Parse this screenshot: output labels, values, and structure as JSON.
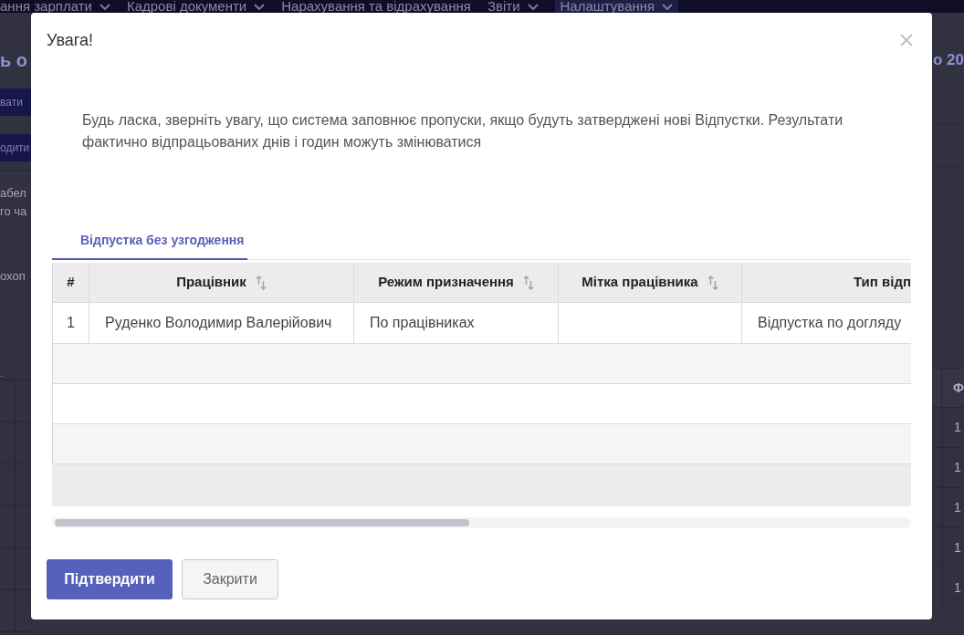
{
  "background": {
    "nav": [
      {
        "label": "ання зарплати",
        "has_menu": true,
        "selected": false
      },
      {
        "label": "Кадрові документи",
        "has_menu": true,
        "selected": false
      },
      {
        "label": "Нарахування та відрахування",
        "has_menu": false,
        "selected": false
      },
      {
        "label": "Звіти",
        "has_menu": true,
        "selected": false
      },
      {
        "label": "Налаштування",
        "has_menu": true,
        "selected": true
      }
    ],
    "page_title_parts": [
      "ь о",
      "о 20"
    ],
    "buttons": [
      "вати",
      "одити"
    ],
    "paragraphs": [
      {
        "lines": [
          "абел",
          "го ча"
        ]
      },
      {
        "lines": [
          "охоп"
        ]
      }
    ],
    "side_table": {
      "header": "Ф",
      "cells": [
        "1",
        "1",
        "1",
        "1",
        "1"
      ]
    }
  },
  "dialog": {
    "title": "Увага!",
    "message": "Будь ласка, зверніть увагу, що система заповнює пропуски, якщо будуть затверджені нові Відпустки. Результати фактично відпрацьованих днів і годин можуть змінюватися",
    "tabs": [
      {
        "label": "Відпустка без узгодження",
        "selected": true
      }
    ],
    "table": {
      "columns": [
        {
          "label": "#",
          "sortable": false
        },
        {
          "label": "Працівник",
          "sortable": true
        },
        {
          "label": "Режим призначення",
          "sortable": true
        },
        {
          "label": "Мітка працівника",
          "sortable": true
        },
        {
          "label": "Тип відп",
          "sortable": false
        }
      ],
      "rows": [
        {
          "cells": [
            "1",
            "Руденко Володимир Валерійович",
            "По працівниках",
            null,
            "Відпустка по догляду"
          ]
        }
      ]
    },
    "buttons": [
      {
        "label": "Підтвердити",
        "kind": "primary"
      },
      {
        "label": "Закрити",
        "kind": "secondary"
      }
    ]
  }
}
